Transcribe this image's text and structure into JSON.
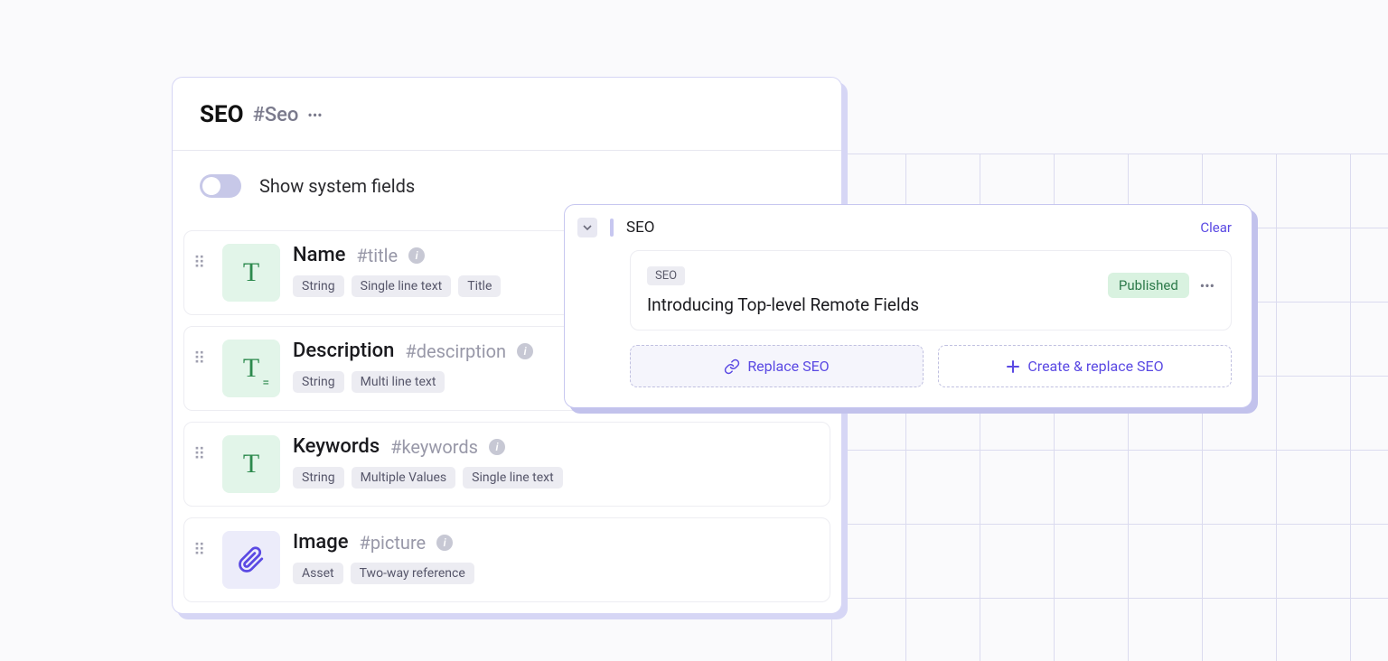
{
  "schema": {
    "title": "SEO",
    "hash": "#Seo",
    "toggle_label": "Show system fields",
    "fields": [
      {
        "icon": "T",
        "icon_variant": "t-green",
        "name": "Name",
        "hash": "#title",
        "tags": [
          "String",
          "Single line text",
          "Title"
        ]
      },
      {
        "icon": "TE",
        "icon_variant": "t-green",
        "name": "Description",
        "hash": "#descirption",
        "tags": [
          "String",
          "Multi line text"
        ]
      },
      {
        "icon": "T",
        "icon_variant": "t-green",
        "name": "Keywords",
        "hash": "#keywords",
        "tags": [
          "String",
          "Multiple Values",
          "Single line text"
        ]
      },
      {
        "icon": "attachment",
        "icon_variant": "t-purple",
        "name": "Image",
        "hash": "#picture",
        "tags": [
          "Asset",
          "Two-way reference"
        ]
      }
    ]
  },
  "reference": {
    "heading": "SEO",
    "clear": "Clear",
    "entry": {
      "badge": "SEO",
      "title": "Introducing Top-level Remote Fields",
      "status": "Published"
    },
    "replace_btn": "Replace SEO",
    "create_btn": "Create & replace SEO"
  }
}
